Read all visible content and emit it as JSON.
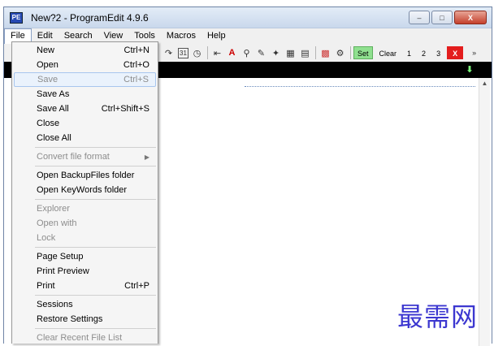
{
  "window": {
    "app_icon": "PE",
    "title": "New?2  -  ProgramEdit 4.9.6",
    "controls": {
      "minimize": "‒",
      "maximize": "□",
      "close": "X"
    }
  },
  "menubar": [
    "File",
    "Edit",
    "Search",
    "View",
    "Tools",
    "Macros",
    "Help"
  ],
  "toolbar": {
    "icons": [
      "redo-icon",
      "calendar-icon",
      "clock-icon",
      "bookmark-icon",
      "font-color-icon",
      "find-icon",
      "replace-icon",
      "wand-icon",
      "picture-icon",
      "picture-edit-icon",
      "palette-icon",
      "settings-icon"
    ],
    "set_label": "Set",
    "clear_label": "Clear",
    "slot1": "1",
    "slot2": "2",
    "slot3": "3",
    "x_label": "X",
    "chevron": "»"
  },
  "file_menu": {
    "new": {
      "label": "New",
      "shortcut": "Ctrl+N"
    },
    "open": {
      "label": "Open",
      "shortcut": "Ctrl+O"
    },
    "save": {
      "label": "Save",
      "shortcut": "Ctrl+S"
    },
    "save_as": {
      "label": "Save As"
    },
    "save_all": {
      "label": "Save All",
      "shortcut": "Ctrl+Shift+S"
    },
    "close": {
      "label": "Close"
    },
    "close_all": {
      "label": "Close All"
    },
    "convert": {
      "label": "Convert file format"
    },
    "open_backup": {
      "label": "Open BackupFiles folder"
    },
    "open_keywords": {
      "label": "Open KeyWords folder"
    },
    "explorer": {
      "label": "Explorer"
    },
    "open_with": {
      "label": "Open with"
    },
    "lock": {
      "label": "Lock"
    },
    "page_setup": {
      "label": "Page Setup"
    },
    "print_preview": {
      "label": "Print Preview"
    },
    "print": {
      "label": "Print",
      "shortcut": "Ctrl+P"
    },
    "sessions": {
      "label": "Sessions"
    },
    "restore": {
      "label": "Restore Settings"
    },
    "clear_recent": {
      "label": "Clear Recent File List"
    }
  },
  "watermark": "最需网",
  "colors": {
    "tab_strip": "#000000",
    "set_button": "#8fe08f",
    "x_button": "#e31d1d",
    "watermark": "#3c37d0"
  }
}
